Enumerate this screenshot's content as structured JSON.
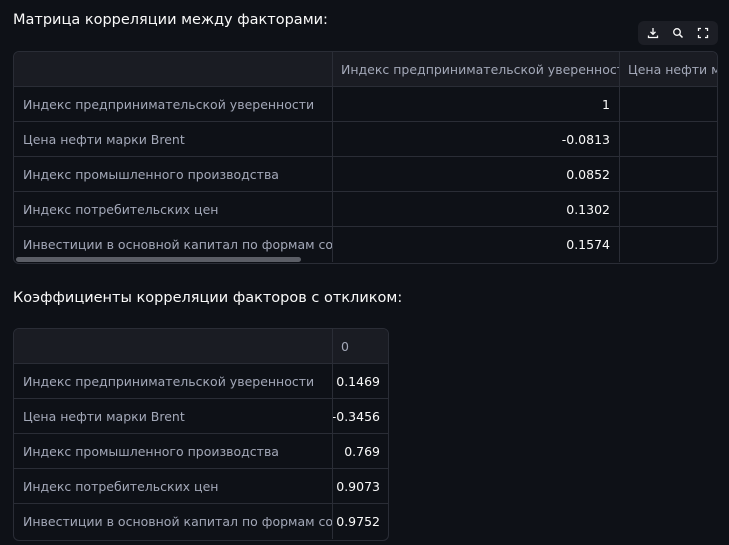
{
  "matrix": {
    "title": "Матрица корреляции между факторами:",
    "columns": [
      "Индекс предпринимательской уверенности",
      "Цена нефти марки Brent"
    ],
    "rows": [
      {
        "label": "Индекс предпринимательской уверенности",
        "value": "1"
      },
      {
        "label": "Цена нефти марки Brent",
        "value": "-0.0813"
      },
      {
        "label": "Индекс промышленного производства",
        "value": "0.0852"
      },
      {
        "label": "Индекс потребительских цен",
        "value": "0.1302"
      },
      {
        "label": "Инвестиции в основной капитал по формам собственности",
        "value": "0.1574"
      }
    ]
  },
  "toolbar": {
    "icons": [
      "download-icon",
      "search-icon",
      "fullscreen-icon"
    ]
  },
  "response": {
    "title": "Коэффициенты корреляции факторов с откликом:",
    "column": "0",
    "rows": [
      {
        "label": "Индекс предпринимательской уверенности",
        "value": "0.1469"
      },
      {
        "label": "Цена нефти марки Brent",
        "value": "-0.3456"
      },
      {
        "label": "Индекс промышленного производства",
        "value": "0.769"
      },
      {
        "label": "Индекс потребительских цен",
        "value": "0.9073"
      },
      {
        "label": "Инвестиции в основной капитал по формам собственности",
        "value": "0.9752"
      }
    ]
  },
  "colors": {
    "background": "#0e1117",
    "header": "#1a1c23",
    "border": "#2a2d36",
    "muted_text": "#a3a8b8",
    "text": "#fafafa"
  }
}
